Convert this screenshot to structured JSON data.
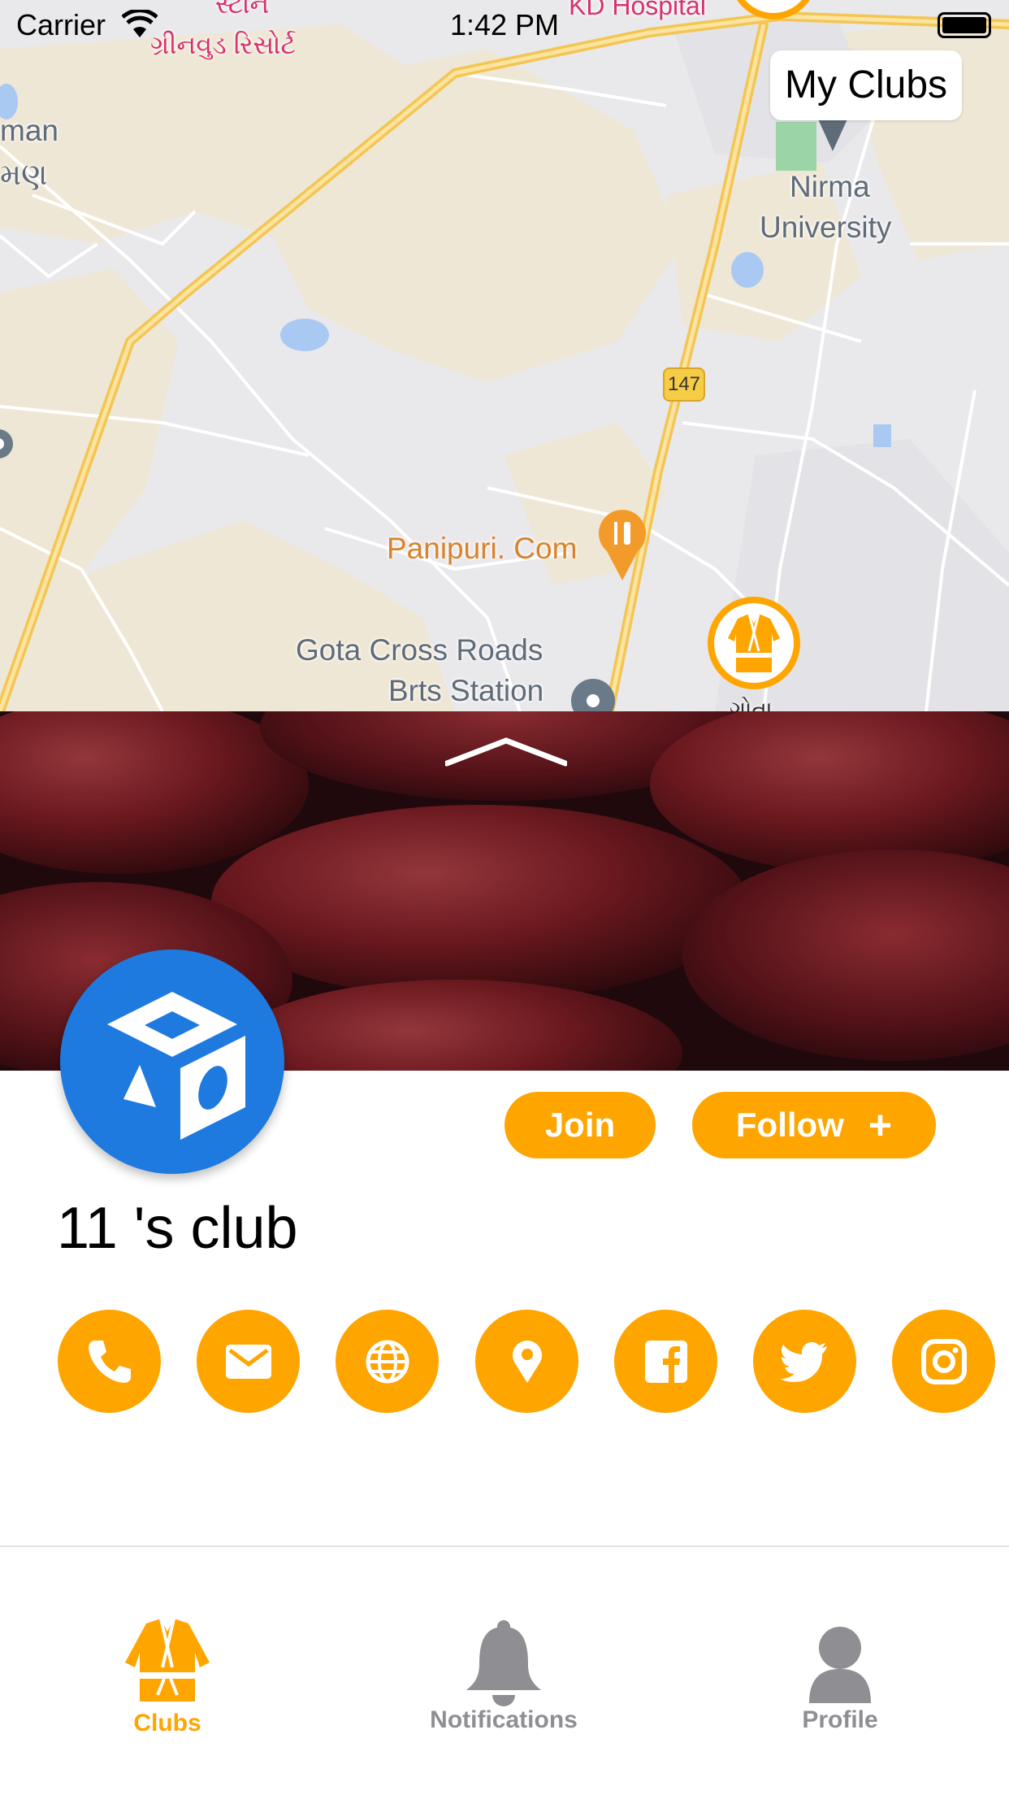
{
  "status_bar": {
    "carrier": "Carrier",
    "time": "1:42 PM"
  },
  "map": {
    "labels": {
      "top_red_1": "સ્ટોન",
      "top_red_2": "ગ્રીનવુડ રિસોર્ટ",
      "top_red_3": "KD Hospital",
      "left_1": "man",
      "left_2": "મણ",
      "nirma_1": "Nirma",
      "nirma_2": "University",
      "highway": "147",
      "panipuri": "Panipuri. Com",
      "gota_1": "Gota Cross Roads",
      "gota_2": "Brts Station",
      "gota_small": "ગોતા"
    },
    "pins": [
      "restaurant-pin",
      "club-marker",
      "transit-pin",
      "university-pin"
    ]
  },
  "header": {
    "my_clubs_label": "My Clubs"
  },
  "club": {
    "name": "11 's club",
    "join_label": "Join",
    "follow_label": "Follow",
    "follow_icon": "+"
  },
  "contact_icons": [
    "phone-icon",
    "email-icon",
    "globe-icon",
    "location-pin-icon",
    "facebook-icon",
    "twitter-icon",
    "instagram-icon"
  ],
  "colors": {
    "accent": "#FFA500",
    "avatar": "#1F7AE0",
    "inactive_tab": "#8E8E93"
  },
  "tabs": [
    {
      "label": "Clubs",
      "icon": "karate-gi-icon",
      "active": true
    },
    {
      "label": "Notifications",
      "icon": "bell-icon",
      "active": false
    },
    {
      "label": "Profile",
      "icon": "person-icon",
      "active": false
    }
  ]
}
